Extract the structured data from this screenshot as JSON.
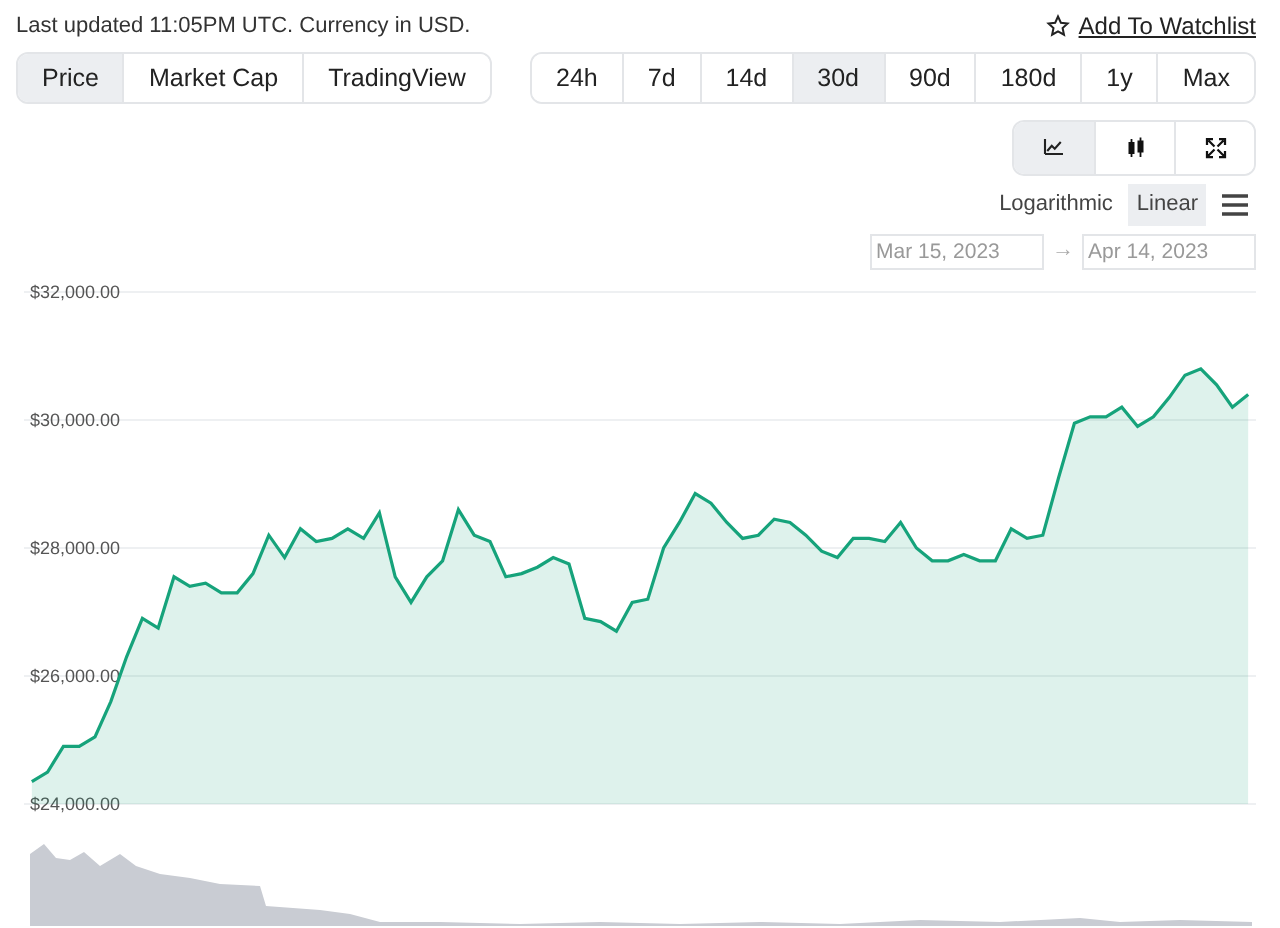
{
  "header": {
    "updated_text": "Last updated 11:05PM UTC. Currency in USD.",
    "watchlist_link": "Add To Watchlist"
  },
  "view_tabs": [
    {
      "label": "Price",
      "selected": true
    },
    {
      "label": "Market Cap",
      "selected": false
    },
    {
      "label": "TradingView",
      "selected": false
    }
  ],
  "ranges": [
    {
      "label": "24h",
      "selected": false
    },
    {
      "label": "7d",
      "selected": false
    },
    {
      "label": "14d",
      "selected": false
    },
    {
      "label": "30d",
      "selected": true
    },
    {
      "label": "90d",
      "selected": false
    },
    {
      "label": "180d",
      "selected": false
    },
    {
      "label": "1y",
      "selected": false
    },
    {
      "label": "Max",
      "selected": false
    }
  ],
  "chart_tools": [
    {
      "kind": "line",
      "selected": true
    },
    {
      "kind": "candlestick",
      "selected": false
    },
    {
      "kind": "fullscreen",
      "selected": false
    }
  ],
  "scale": [
    {
      "label": "Logarithmic",
      "selected": false
    },
    {
      "label": "Linear",
      "selected": true
    }
  ],
  "date_range": {
    "from": "Mar 15, 2023",
    "separator": "→",
    "to": "Apr 14, 2023"
  },
  "chart": {
    "chart_data": {
      "type": "area",
      "ylim": [
        24000,
        32000
      ],
      "grid": true,
      "categories": [
        null,
        null,
        null,
        null,
        null,
        null,
        null,
        null,
        null,
        null,
        null,
        null,
        null,
        null,
        null,
        null,
        null,
        null,
        null,
        null,
        null,
        null,
        null,
        null,
        null,
        null,
        null,
        null,
        null,
        null,
        null,
        null,
        null,
        null,
        null,
        null,
        null,
        null,
        null,
        null,
        null,
        null,
        null,
        null,
        null,
        null,
        null,
        null,
        null,
        null,
        null,
        null,
        null,
        null,
        null,
        null,
        null,
        null,
        null,
        null,
        null,
        null,
        null,
        null,
        null,
        null,
        null,
        null,
        null,
        null,
        null,
        null,
        null,
        null,
        null,
        null,
        null,
        null
      ],
      "yticks": [
        {
          "value": 24000,
          "label": "$24,000.00"
        },
        {
          "value": 26000,
          "label": "$26,000.00"
        },
        {
          "value": 28000,
          "label": "$28,000.00"
        },
        {
          "value": 30000,
          "label": "$30,000.00"
        },
        {
          "value": 32000,
          "label": "$32,000.00"
        }
      ],
      "series": [
        {
          "color": "#16a37b",
          "values": [
            24350,
            24500,
            24900,
            24900,
            25050,
            25600,
            26300,
            26900,
            26750,
            27550,
            27400,
            27450,
            27300,
            27300,
            27600,
            28200,
            27850,
            28300,
            28100,
            28150,
            28300,
            28150,
            28550,
            27550,
            27150,
            27550,
            27800,
            28600,
            28200,
            28100,
            27550,
            27600,
            27700,
            27850,
            27750,
            26900,
            26850,
            26700,
            27150,
            27200,
            28000,
            28400,
            28850,
            28700,
            28400,
            28150,
            28200,
            28450,
            28400,
            28200,
            27950,
            27850,
            28150,
            28150,
            28100,
            28400,
            28000,
            27800,
            27800,
            27900,
            27800,
            27800,
            28300,
            28150,
            28200,
            29100,
            29950,
            30050,
            30050,
            30200,
            29900,
            30050,
            30350,
            30700,
            30800,
            30550,
            30200,
            30400
          ]
        }
      ]
    }
  }
}
